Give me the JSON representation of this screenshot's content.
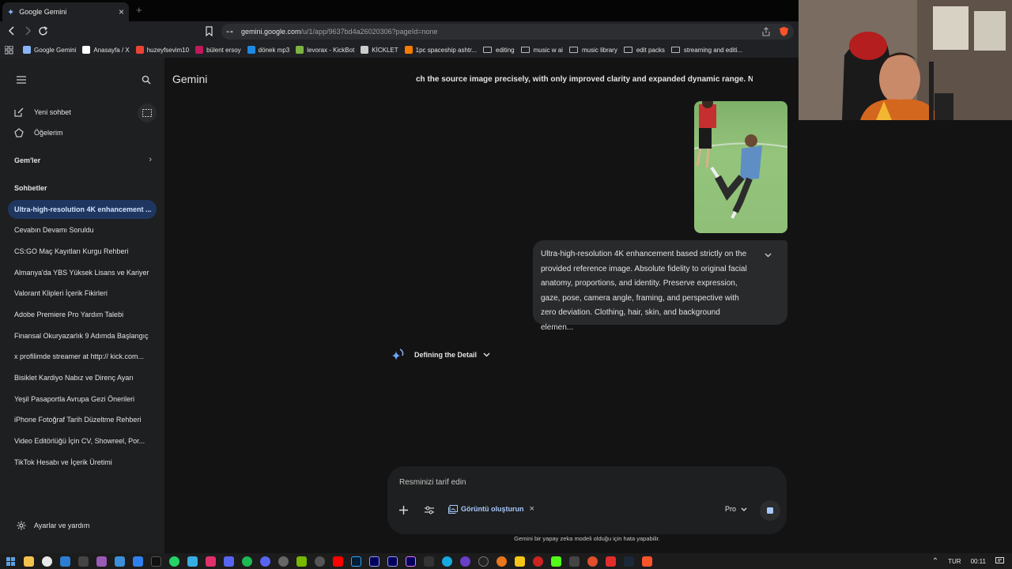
{
  "tab": {
    "title": "Google Gemini"
  },
  "address": {
    "host": "gemini.google.com",
    "path": "/u/1/app/9637bd4a26020306?pageId=none"
  },
  "bookmarks": [
    {
      "label": "Google Gemini",
      "icon": "gemini-icon",
      "color": "#8ab4f8"
    },
    {
      "label": "Anasayfa / X",
      "icon": "x-logo-icon",
      "color": "#ffffff"
    },
    {
      "label": "huzeyfsevim10",
      "icon": "gmail-icon",
      "color": "#ea4335"
    },
    {
      "label": "bülent ersoy",
      "icon": "site-icon",
      "color": "#c2185b"
    },
    {
      "label": "dönek mp3",
      "icon": "site-icon",
      "color": "#1e88e5"
    },
    {
      "label": "levorax - KickBot",
      "icon": "bot-icon",
      "color": "#7cb342"
    },
    {
      "label": "KİCKLET",
      "icon": "kicklet-icon",
      "color": "#cccccc"
    },
    {
      "label": "1pc spaceship ashtr...",
      "icon": "shop-icon",
      "color": "#f57c00"
    },
    {
      "label": "editing",
      "icon": "folder-icon"
    },
    {
      "label": "music w ai",
      "icon": "folder-icon"
    },
    {
      "label": "music library",
      "icon": "folder-icon"
    },
    {
      "label": "edit packs",
      "icon": "folder-icon"
    },
    {
      "label": "streaming and editi...",
      "icon": "folder-icon"
    }
  ],
  "sidebar": {
    "new_chat": "Yeni sohbet",
    "my_stuff": "Öğelerim",
    "gems": "Gem'ler",
    "chats_header": "Sohbetler",
    "chats": [
      "Ultra-high-resolution 4K enhancement ...",
      "Cevabın Devamı Soruldu",
      "CS:GO Maç Kayıtları Kurgu Rehberi",
      "Almanya'da YBS Yüksek Lisans ve Kariyer",
      "Valorant Klipleri İçerik Fikirleri",
      "Adobe Premiere Pro Yardım Talebi",
      "Finansal Okuryazarlık 9 Adımda Başlangıç",
      "x profilimde streamer at http:// kick.com...",
      "Bisiklet Kardiyo Nabız ve Direnç Ayarı",
      "Yeşil Pasaportla Avrupa Gezi Önerileri",
      "iPhone Fotoğraf Tarih Düzeltme Rehberi",
      "Video Editörlüğü İçin CV, Showreel, Por...",
      "TikTok Hesabı ve İçerik Üretimi"
    ],
    "settings": "Ayarlar ve yardım"
  },
  "main": {
    "title": "Gemini",
    "scroll_text": "ch the source image precisely, with only improved clarity and expanded dynamic range. Nc",
    "prompt_text": "Ultra-high-resolution 4K enhancement based strictly on the provided reference image. Absolute fidelity to original facial anatomy, proportions, and identity. Preserve expression, gaze, pose, camera angle, framing, and perspective with zero deviation. Clothing, hair, skin, and background elemen...",
    "thinking_label": "Defining the Detail",
    "input_placeholder": "Resminizi tarif edin",
    "tool_chip": "Görüntü oluşturun",
    "model": "Pro",
    "disclaimer": "Gemini bir yapay zeka modeli olduğu için hata yapabilir."
  },
  "taskbar": {
    "lang": "TUR",
    "time": "00:11"
  }
}
